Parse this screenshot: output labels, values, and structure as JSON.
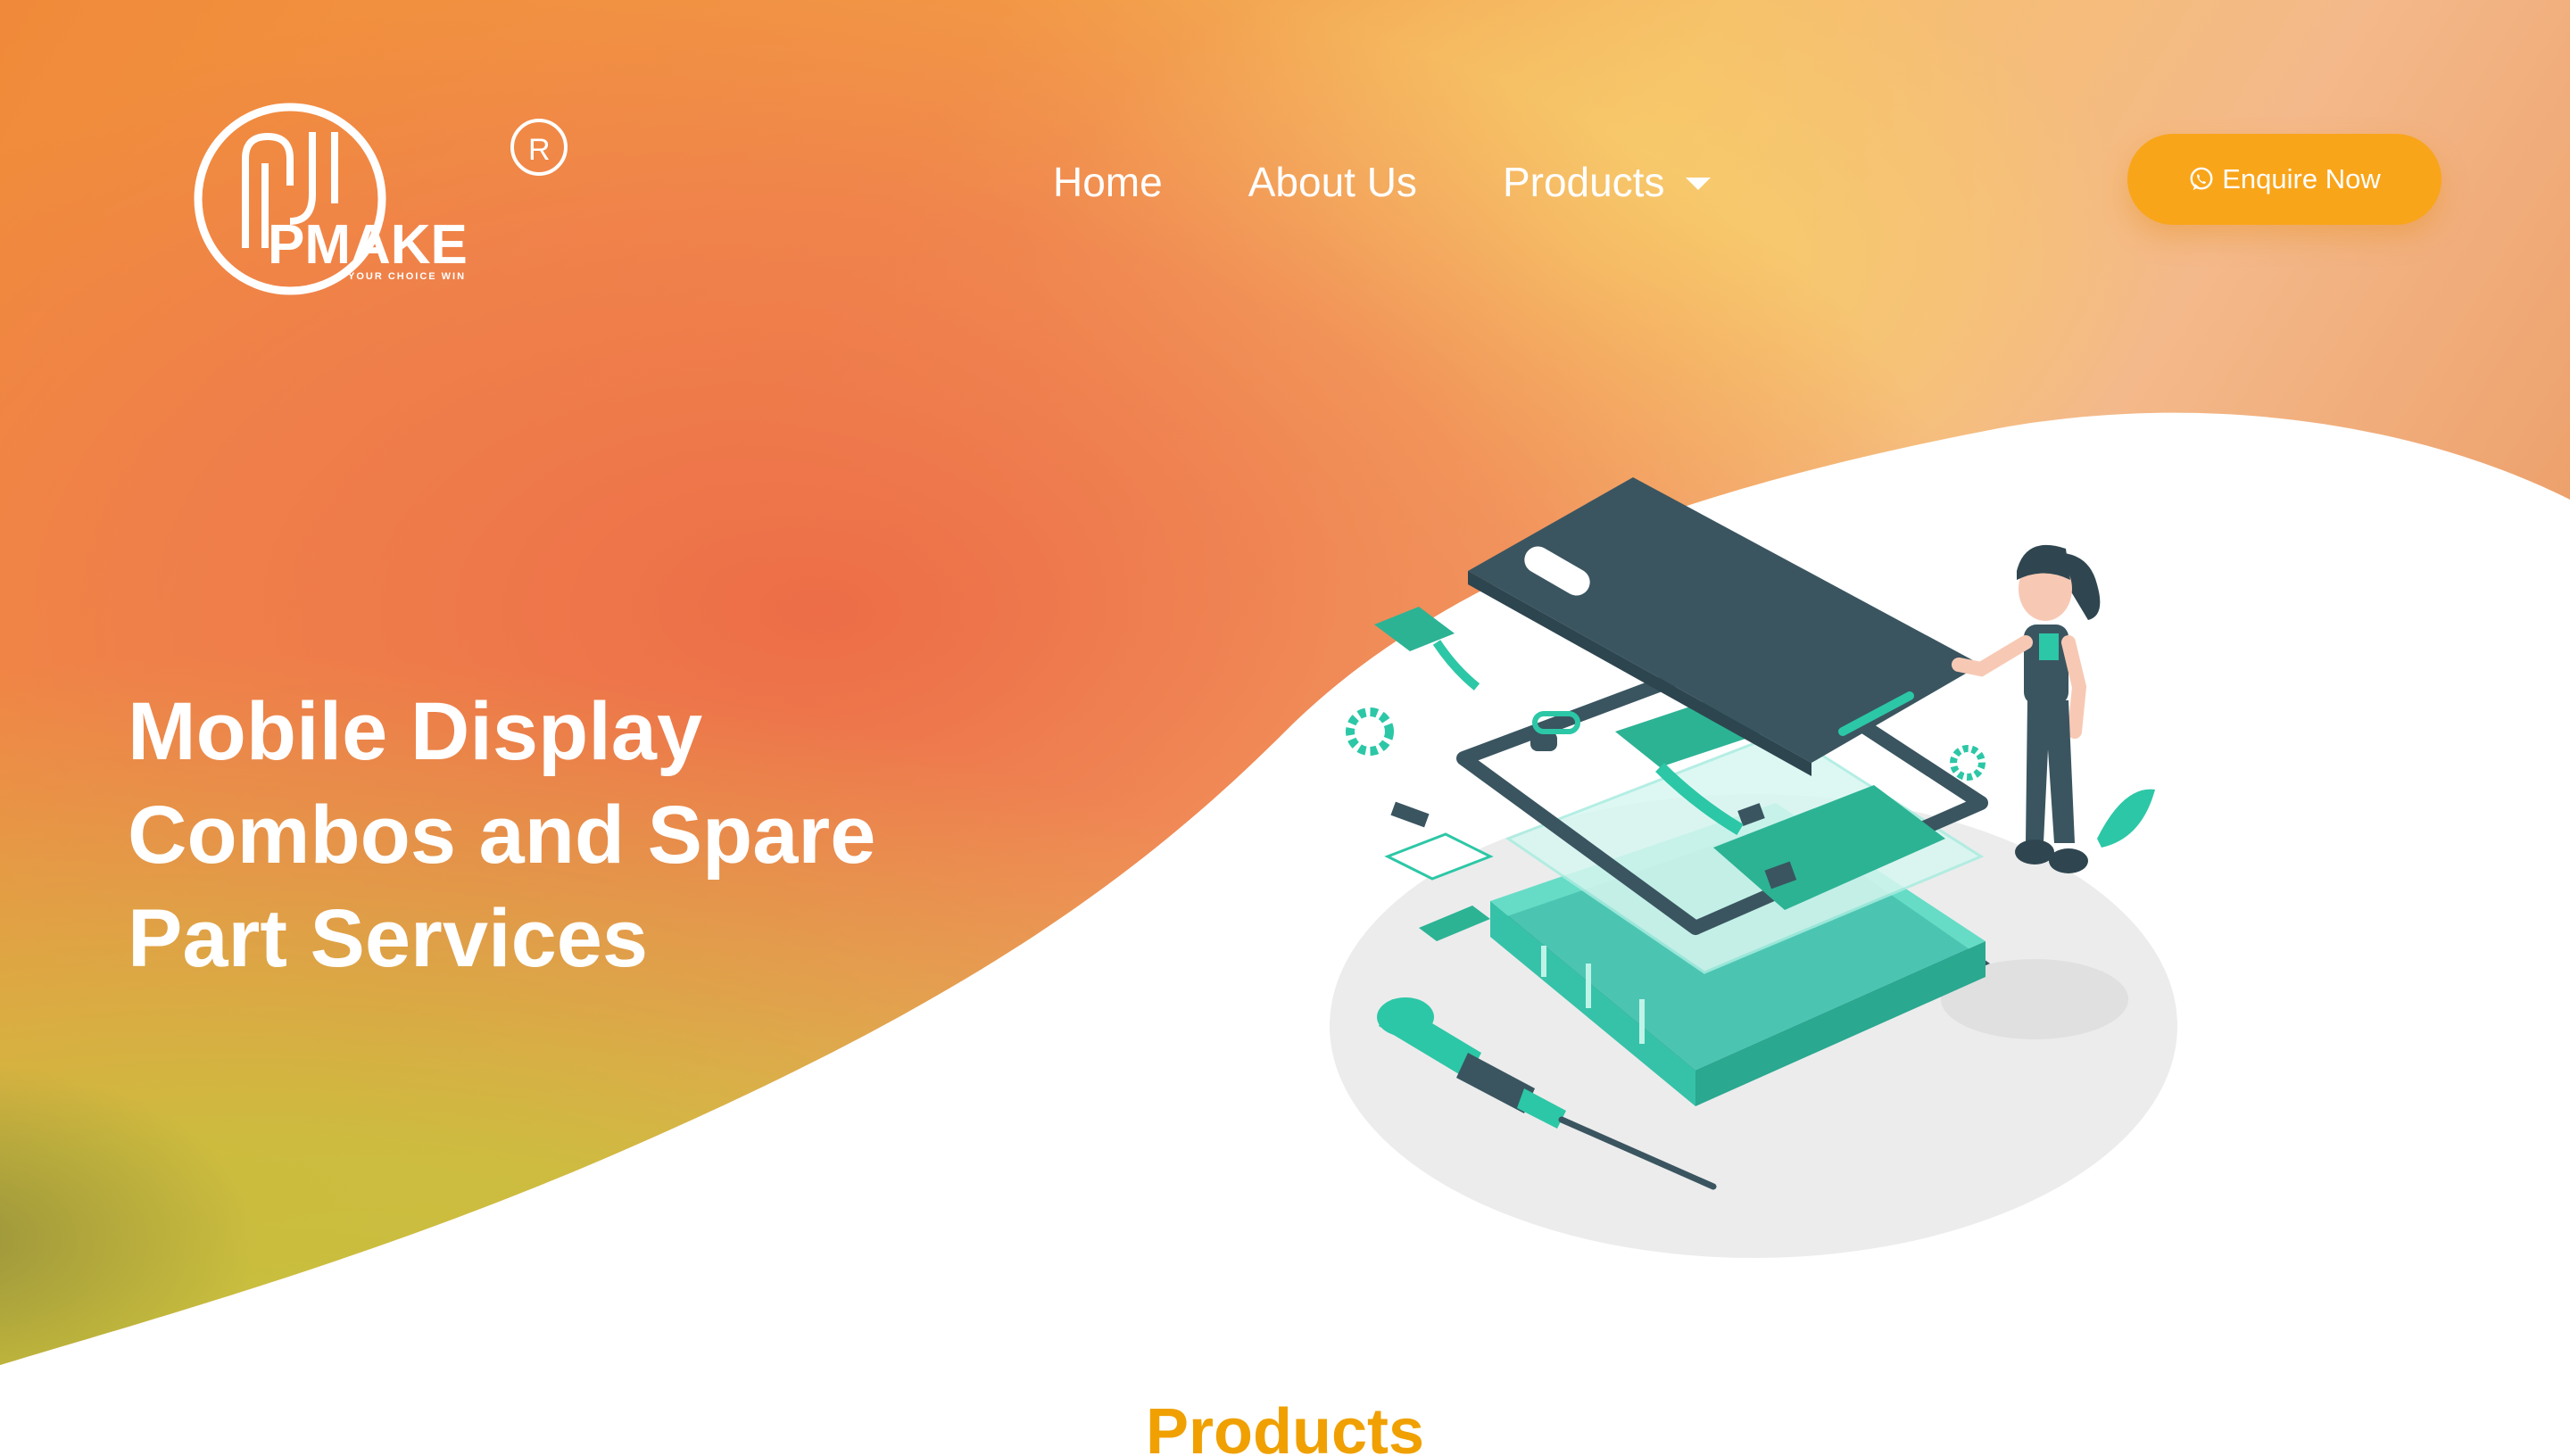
{
  "brand": {
    "logo_text": "PMAKE",
    "logo_tagline": "YOUR CHOICE WIN",
    "registered_mark": "R"
  },
  "nav": {
    "items": [
      {
        "label": "Home"
      },
      {
        "label": "About Us"
      },
      {
        "label": "Products",
        "has_dropdown": true
      }
    ]
  },
  "cta": {
    "label": "Enquire Now",
    "icon": "whatsapp-icon"
  },
  "hero": {
    "title_lines": [
      "Mobile Display",
      "Combos and Spare",
      "Part Services"
    ]
  },
  "sections": {
    "products_title": "Products"
  },
  "colors": {
    "accent_orange": "#f9a51a",
    "heading_orange": "#f0a000",
    "gradient_red": "#ec6b45",
    "gradient_yellow": "#c8c23a",
    "illustration_teal": "#2cc7a6",
    "illustration_dark": "#3a5560"
  }
}
